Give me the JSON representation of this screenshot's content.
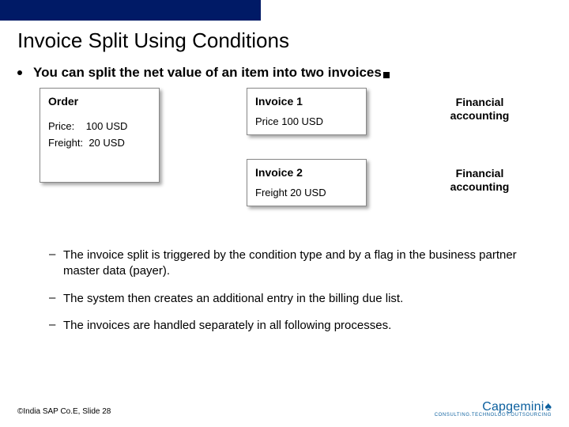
{
  "title": "Invoice Split Using Conditions",
  "main_bullet": "You can split the net value of an item into two invoices",
  "order": {
    "header": "Order",
    "price_label": "Price:",
    "price_value": "100 USD",
    "freight_label": "Freight:",
    "freight_value": "20 USD"
  },
  "invoice1": {
    "header": "Invoice 1",
    "line": "Price 100 USD"
  },
  "invoice2": {
    "header": "Invoice 2",
    "line": "Freight 20 USD"
  },
  "fa_label": "Financial accounting",
  "sub_bullets": [
    "The invoice split is triggered by the condition type and by a flag in the business partner master data (payer).",
    "The system then creates an additional entry in the billing due list.",
    "The invoices are handled separately in all following processes."
  ],
  "footer": "©India SAP Co.E, Slide 28",
  "logo": {
    "name": "Capgemini",
    "tagline": "CONSULTING.TECHNOLOGY.OUTSOURCING"
  }
}
